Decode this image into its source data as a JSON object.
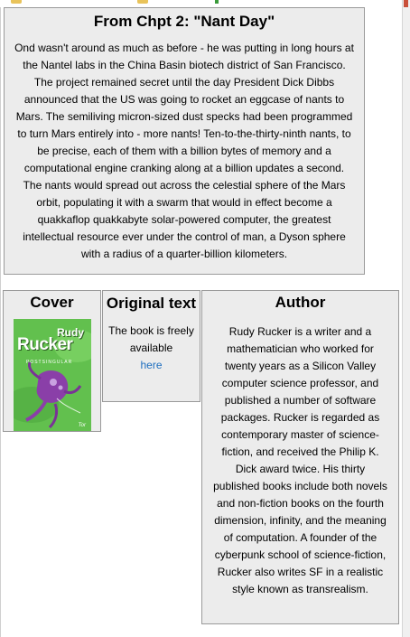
{
  "excerpt": {
    "title": "From Chpt 2: \"Nant Day\"",
    "body": "Ond wasn't around as much as before - he was putting in long hours at the Nantel labs in the China Basin biotech district of San Francisco. The project remained secret until the day President Dick Dibbs announced that the US was going to rocket an eggcase of nants to Mars. The semiliving micron-sized dust specks had been programmed to turn Mars entirely into - more nants! Ten-to-the-thirty-ninth nants, to be precise, each of them with a billion bytes of memory and a computational engine cranking along at a billion updates a second. The nants would spread out across the celestial sphere of the Mars orbit, populating it with a swarm that would in effect become a quakkaflop quakkabyte solar-powered computer, the greatest intellectual resource ever under the control of man, a Dyson sphere with a radius of a quarter-billion kilometers."
  },
  "cover": {
    "heading": "Cover",
    "image": {
      "author_first": "Rudy",
      "author_last": "Rucker",
      "subtitle": "POSTSINGULAR",
      "publisher": "Tor",
      "colors": {
        "background": "#6cc455",
        "creature": "#8a3fa8"
      }
    }
  },
  "original": {
    "heading": "Original text",
    "text": "The book is freely available",
    "link_label": "here"
  },
  "author": {
    "heading": "Author",
    "bio": "Rudy Rucker is a writer and a mathematician who worked for twenty years as a Silicon Valley computer science professor, and published a number of software packages. Rucker is regarded as contemporary master of science-fiction, and received the Philip K. Dick award twice. His thirty published books include both novels and non-fiction books on the fourth dimension, infinity, and the meaning of computation. A founder of the cyberpunk school of science-fiction, Rucker also writes SF in a realistic style known as transrealism."
  },
  "colors": {
    "panel_bg": "#ececec",
    "panel_border": "#9a9a9a",
    "link": "#1f6fbf"
  }
}
